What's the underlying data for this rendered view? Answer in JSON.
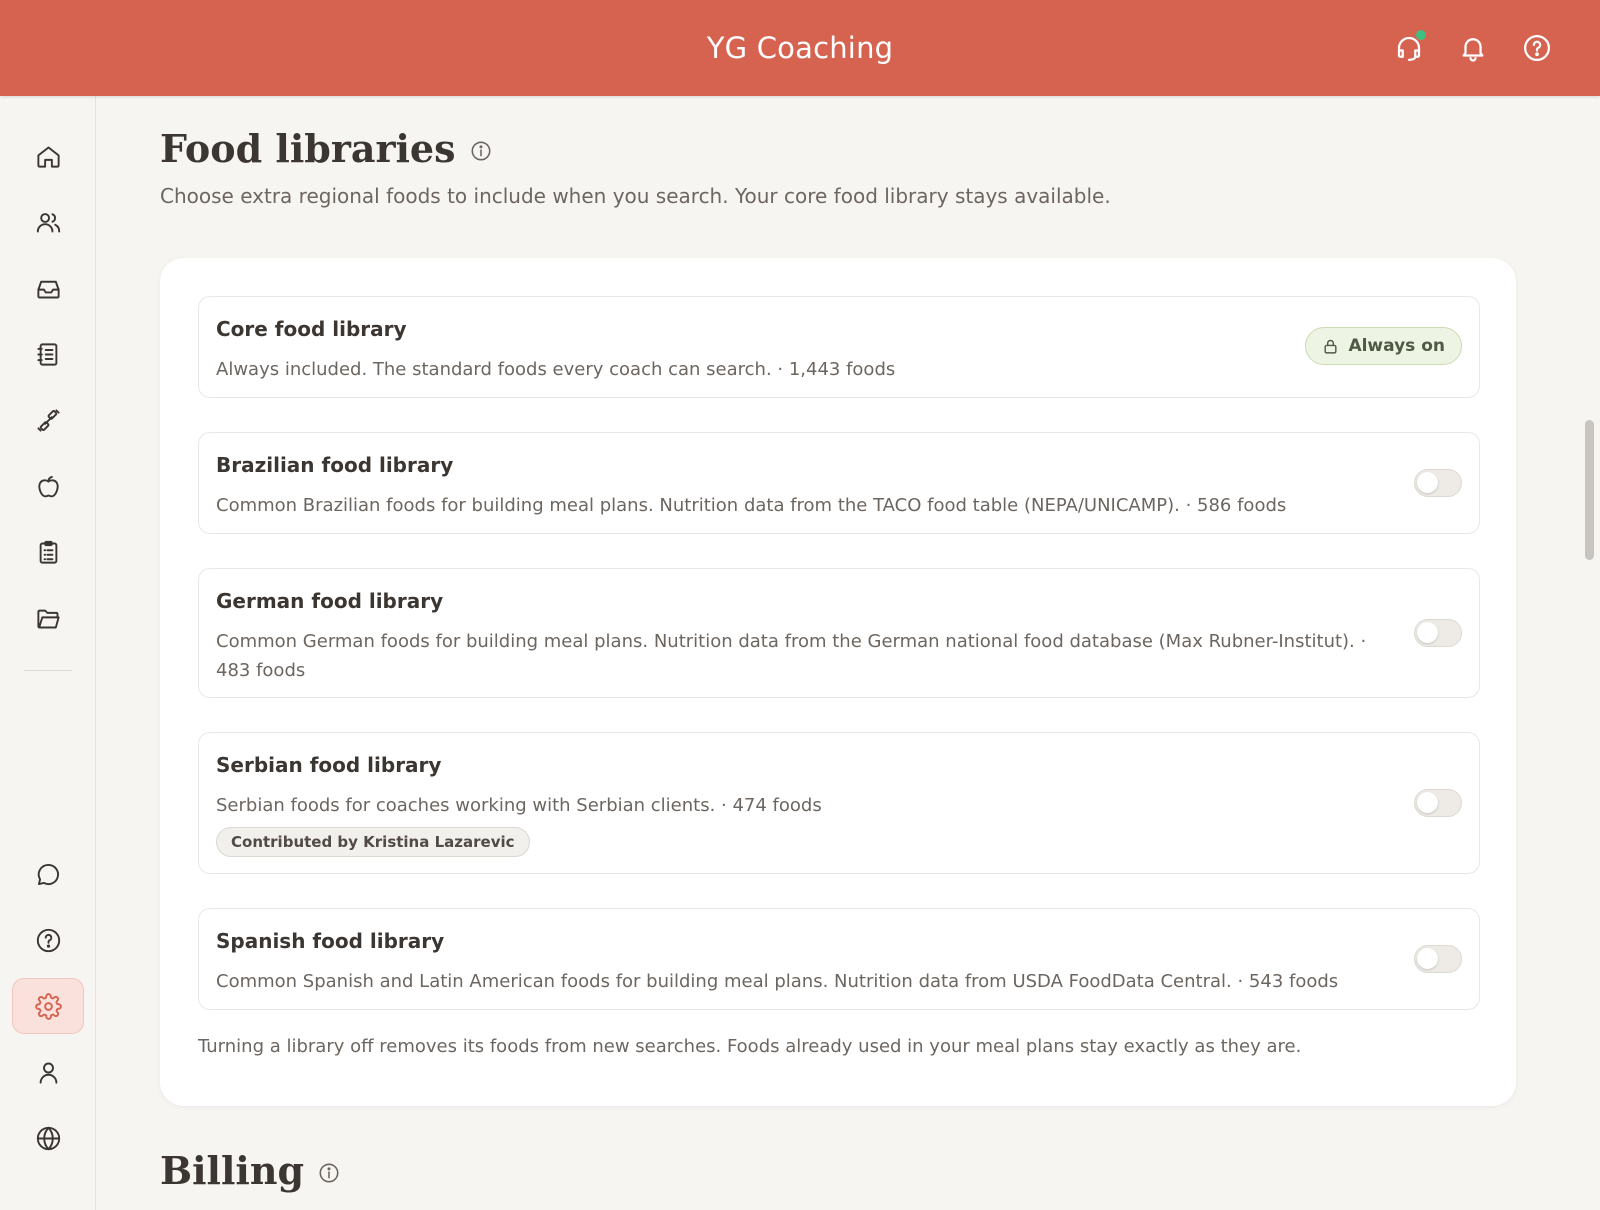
{
  "header": {
    "title": "YG Coaching",
    "icons": [
      "headset-icon",
      "bell-icon",
      "help-icon"
    ]
  },
  "sidebar": {
    "items": [
      {
        "icon": "home-icon"
      },
      {
        "icon": "users-icon"
      },
      {
        "icon": "inbox-icon"
      },
      {
        "icon": "notebook-icon"
      },
      {
        "icon": "dumbbell-icon"
      },
      {
        "icon": "apple-icon"
      },
      {
        "icon": "clipboard-icon"
      },
      {
        "icon": "folder-icon"
      },
      {
        "icon": "chat-icon"
      },
      {
        "icon": "help-icon"
      },
      {
        "icon": "gear-icon",
        "active": true
      },
      {
        "icon": "user-icon"
      },
      {
        "icon": "globe-icon"
      }
    ]
  },
  "food_libraries": {
    "title": "Food libraries",
    "subtitle": "Choose extra regional foods to include when you search. Your core food library stays available.",
    "libraries": [
      {
        "name": "Core food library",
        "description": "Always included. The standard foods every coach can search. · 1,443 foods",
        "status": "Always on"
      },
      {
        "name": "Brazilian food library",
        "description": "Common Brazilian foods for building meal plans. Nutrition data from the TACO food table (NEPA/UNICAMP). · 586 foods",
        "enabled": false
      },
      {
        "name": "German food library",
        "description": "Common German foods for building meal plans. Nutrition data from the German national food database (Max Rubner-Institut). · 483 foods",
        "enabled": false
      },
      {
        "name": "Serbian food library",
        "description": "Serbian foods for coaches working with Serbian clients. · 474 foods",
        "contributor": "Contributed by Kristina Lazarevic",
        "enabled": false
      },
      {
        "name": "Spanish food library",
        "description": "Common Spanish and Latin American foods for building meal plans. Nutrition data from USDA FoodData Central. · 543 foods",
        "enabled": false
      }
    ],
    "footer_note": "Turning a library off removes its foods from new searches. Foods already used in your meal plans stay exactly as they are."
  },
  "billing": {
    "title": "Billing"
  },
  "colors": {
    "brand": "#d66350",
    "active_nav_bg": "#fbe1dc",
    "always_on_bg": "#eef4e4"
  }
}
